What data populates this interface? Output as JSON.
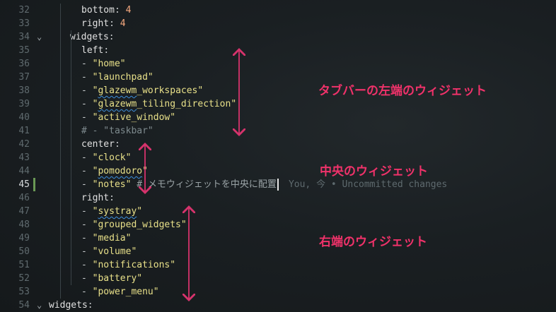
{
  "lines": [
    {
      "n": "32",
      "indent": 7,
      "parts": [
        [
          "k",
          "bottom"
        ],
        [
          "dash",
          ": "
        ],
        [
          "num",
          "4"
        ]
      ]
    },
    {
      "n": "33",
      "indent": 7,
      "parts": [
        [
          "k",
          "right"
        ],
        [
          "dash",
          ": "
        ],
        [
          "num",
          "4"
        ]
      ]
    },
    {
      "n": "34",
      "indent": 6,
      "fold": true,
      "parts": [
        [
          "k",
          "widgets"
        ],
        [
          "dash",
          ":"
        ]
      ]
    },
    {
      "n": "35",
      "indent": 7,
      "parts": [
        [
          "k",
          "left"
        ],
        [
          "dash",
          ":"
        ]
      ]
    },
    {
      "n": "36",
      "indent": 7,
      "parts": [
        [
          "dash",
          "- "
        ],
        [
          "str",
          "\"home\""
        ]
      ]
    },
    {
      "n": "37",
      "indent": 7,
      "parts": [
        [
          "dash",
          "- "
        ],
        [
          "str",
          "\"launchpad\""
        ]
      ]
    },
    {
      "n": "38",
      "indent": 7,
      "parts": [
        [
          "dash",
          "- "
        ],
        [
          "str",
          "\""
        ],
        [
          "str sq",
          "glazewm"
        ],
        [
          "str",
          "_workspaces\""
        ]
      ]
    },
    {
      "n": "39",
      "indent": 7,
      "parts": [
        [
          "dash",
          "- "
        ],
        [
          "str",
          "\""
        ],
        [
          "str sq",
          "glazewm"
        ],
        [
          "str",
          "_tiling_direction\""
        ]
      ]
    },
    {
      "n": "40",
      "indent": 7,
      "parts": [
        [
          "dash",
          "- "
        ],
        [
          "str",
          "\"active_window\""
        ]
      ]
    },
    {
      "n": "41",
      "indent": 7,
      "parts": [
        [
          "cmt",
          "# - \"taskbar\""
        ]
      ]
    },
    {
      "n": "42",
      "indent": 7,
      "parts": [
        [
          "k",
          "center"
        ],
        [
          "dash",
          ":"
        ]
      ]
    },
    {
      "n": "43",
      "indent": 7,
      "parts": [
        [
          "dash",
          "- "
        ],
        [
          "str",
          "\"clock\""
        ]
      ]
    },
    {
      "n": "44",
      "indent": 7,
      "parts": [
        [
          "dash",
          "- "
        ],
        [
          "str",
          "\""
        ],
        [
          "str sq",
          "pomodoro"
        ],
        [
          "str",
          "\""
        ]
      ]
    },
    {
      "n": "45",
      "indent": 7,
      "active": true,
      "parts": [
        [
          "dash",
          "- "
        ],
        [
          "str",
          "\"notes\""
        ],
        [
          "dash",
          " "
        ],
        [
          "cmt2",
          "# メモウィジェットを中央に配置"
        ]
      ]
    },
    {
      "n": "46",
      "indent": 7,
      "parts": [
        [
          "k",
          "right"
        ],
        [
          "dash",
          ":"
        ]
      ]
    },
    {
      "n": "47",
      "indent": 7,
      "parts": [
        [
          "dash",
          "- "
        ],
        [
          "str",
          "\""
        ],
        [
          "str sq",
          "systray"
        ],
        [
          "str",
          "\""
        ]
      ]
    },
    {
      "n": "48",
      "indent": 7,
      "parts": [
        [
          "dash",
          "- "
        ],
        [
          "str",
          "\"grouped_widgets\""
        ]
      ]
    },
    {
      "n": "49",
      "indent": 7,
      "parts": [
        [
          "dash",
          "- "
        ],
        [
          "str",
          "\"media\""
        ]
      ]
    },
    {
      "n": "50",
      "indent": 7,
      "parts": [
        [
          "dash",
          "- "
        ],
        [
          "str",
          "\"volume\""
        ]
      ]
    },
    {
      "n": "51",
      "indent": 7,
      "parts": [
        [
          "dash",
          "- "
        ],
        [
          "str",
          "\"notifications\""
        ]
      ]
    },
    {
      "n": "52",
      "indent": 7,
      "parts": [
        [
          "dash",
          "- "
        ],
        [
          "str",
          "\"battery\""
        ]
      ]
    },
    {
      "n": "53",
      "indent": 7,
      "parts": [
        [
          "dash",
          "- "
        ],
        [
          "str",
          "\"power_menu\""
        ]
      ]
    },
    {
      "n": "54",
      "indent": 0,
      "fold": true,
      "parts": [
        [
          "k",
          "widgets"
        ],
        [
          "dash",
          ":"
        ]
      ]
    }
  ],
  "blame": "You, 今 • Uncommitted changes",
  "annotations": {
    "left_label": "タブバーの左端のウィジェット",
    "center_label": "中央のウィジェット",
    "right_label": "右端のウィジェット"
  },
  "colors": {
    "annotation": "#f0326a",
    "gutter_modified": "#6a9955"
  }
}
